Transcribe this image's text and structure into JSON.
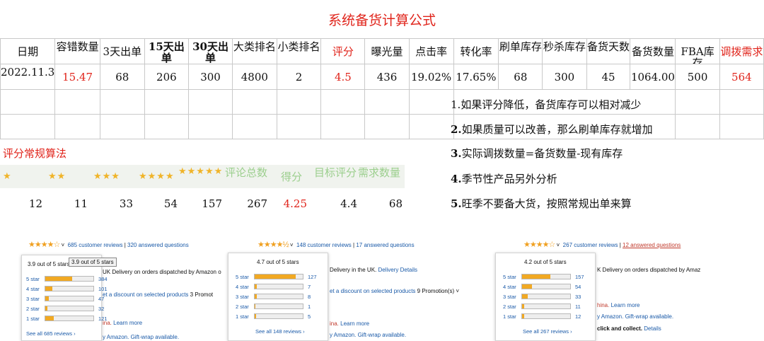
{
  "title": "系统备货计算公式",
  "headers": [
    "日期",
    "容错数量",
    "3天出单",
    "15天出单",
    "30天出单",
    "大类排名",
    "小类排名",
    "评分",
    "曝光量",
    "点击率",
    "转化率",
    "刷单库存",
    "秒杀库存",
    "备货天数",
    "备货数量",
    "FBA库存",
    "调拨需求"
  ],
  "values": [
    "2022.11.3",
    "15.47",
    "68",
    "206",
    "300",
    "4800",
    "2",
    "4.5",
    "436",
    "19.02%",
    "17.65%",
    "68",
    "300",
    "45",
    "1064.00",
    "500",
    "564"
  ],
  "notes": [
    {
      "num": "1.",
      "text": "如果评分降低，备货库存可以相对减少"
    },
    {
      "num": "2.",
      "text": "如果质量可以改善，那么刷单库存就增加"
    },
    {
      "num": "3.",
      "text": "实际调拨数量=备货数量-现有库存"
    },
    {
      "num": "4.",
      "text": "季节性产品另外分析"
    },
    {
      "num": "5.",
      "text": "旺季不要备大货，按照常规出单来算"
    }
  ],
  "score_title": "评分常规算法",
  "star_groups": [
    "★",
    "★★",
    "★★★",
    "★★★★",
    "★★★★★"
  ],
  "score_headers": {
    "review_total": "评论总数",
    "score": "得分",
    "target": "目标评分",
    "demand": "需求数量"
  },
  "score_values": {
    "s1": "12",
    "s2": "11",
    "s3": "33",
    "s4": "54",
    "s5": "157",
    "review_total": "267",
    "score": "4.25",
    "target": "4.4",
    "demand": "68"
  },
  "shots": [
    {
      "stars": "★★★★☆",
      "reviews": "685 customer reviews",
      "sep": "|",
      "questions": "320 answered questions",
      "avg": "3.9 out of 5 stars",
      "tooltip": "3.9 out of 5 stars",
      "rows": [
        {
          "label": "5 star",
          "count": "384",
          "pct": 0.56
        },
        {
          "label": "4 star",
          "count": "101",
          "pct": 0.15
        },
        {
          "label": "3 star",
          "count": "47",
          "pct": 0.07
        },
        {
          "label": "2 star",
          "count": "32",
          "pct": 0.05
        },
        {
          "label": "1 star",
          "count": "121",
          "pct": 0.18
        }
      ],
      "see_all": "See all 685 reviews ›",
      "side1": "UK Delivery on orders dispatched by Amazon o",
      "side2": "et a discount on selected products",
      "side2b": "3 Promot",
      "side3": "ina.",
      "side3b": "Learn more",
      "side4": "y Amazon. Gift-wrap available."
    },
    {
      "stars": "★★★★½",
      "reviews": "148 customer reviews",
      "sep": "|",
      "questions": "17 answered questions",
      "avg": "4.7 out of 5 stars",
      "rows": [
        {
          "label": "5 star",
          "count": "127",
          "pct": 0.86
        },
        {
          "label": "4 star",
          "count": "7",
          "pct": 0.05
        },
        {
          "label": "3 star",
          "count": "8",
          "pct": 0.05
        },
        {
          "label": "2 star",
          "count": "1",
          "pct": 0.01
        },
        {
          "label": "1 star",
          "count": "5",
          "pct": 0.03
        }
      ],
      "see_all": "See all 148 reviews ›",
      "side1": "Delivery in the UK.",
      "side1b": "Delivery Details",
      "side2": "et a discount on selected products",
      "side2b": "9 Promotion(s) ˅",
      "side3": "ina.",
      "side3b": "Learn more",
      "side4": "y Amazon. Gift-wrap available."
    },
    {
      "stars": "★★★★☆",
      "reviews": "267 customer reviews",
      "sep": "|",
      "questions": "12 answered questions",
      "avg": "4.2 out of 5 stars",
      "rows": [
        {
          "label": "5 star",
          "count": "157",
          "pct": 0.59
        },
        {
          "label": "4 star",
          "count": "54",
          "pct": 0.2
        },
        {
          "label": "3 star",
          "count": "33",
          "pct": 0.12
        },
        {
          "label": "2 star",
          "count": "11",
          "pct": 0.04
        },
        {
          "label": "1 star",
          "count": "12",
          "pct": 0.04
        }
      ],
      "see_all": "See all 267 reviews ›",
      "side1": "K Delivery on orders dispatched by Amaz",
      "side2": "hina.",
      "side2b": "Learn more",
      "side3": "y Amazon. Gift-wrap available.",
      "side4": "click and collect.",
      "side4b": "Details"
    }
  ]
}
